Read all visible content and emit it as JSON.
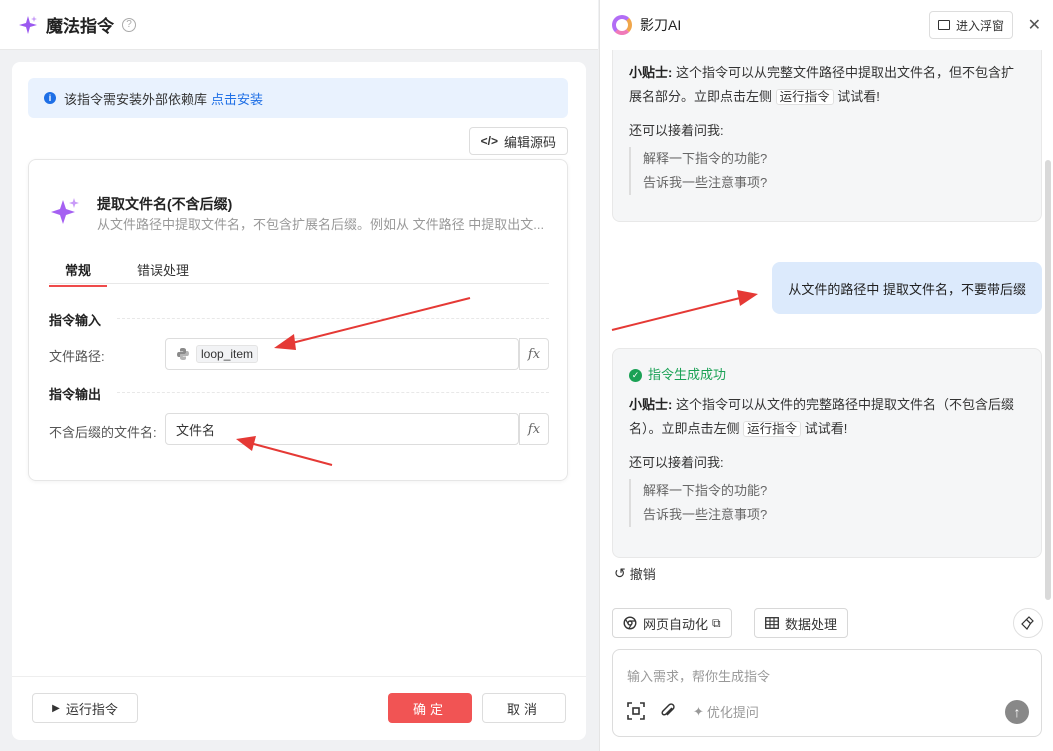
{
  "left": {
    "title": "魔法指令",
    "help": "?",
    "notice": {
      "text": "该指令需安装外部依赖库",
      "link": "点击安装"
    },
    "edit_source": "编辑源码",
    "command": {
      "title": "提取文件名(不含后缀)",
      "description": "从文件路径中提取文件名，不包含扩展名后缀。例如从 文件路径 中提取出文..."
    },
    "tabs": {
      "general": "常规",
      "error": "错误处理"
    },
    "input_section": "指令输入",
    "input_field": {
      "label": "文件路径:",
      "chip": "loop_item"
    },
    "output_section": "指令输出",
    "output_field": {
      "label": "不含后缀的文件名:",
      "value": "文件名"
    },
    "fx": "fx",
    "run_button": "运行指令",
    "ok_button": "确定",
    "cancel_button": "取消"
  },
  "right": {
    "title": "影刀AI",
    "float_button": "进入浮窗",
    "msg1": {
      "tip_label": "小贴士",
      "tip_a": "这个指令可以从完整文件路径中提取出文件名，但不包含扩展名部分。立即点击左侧",
      "tag": "运行指令",
      "tip_b": "试试看!",
      "ask": "还可以接着问我:",
      "q1": "解释一下指令的功能?",
      "q2": "告诉我一些注意事项?"
    },
    "user_msg": "从文件的路径中 提取文件名，不要带后缀",
    "msg2": {
      "success": "指令生成成功",
      "tip_label": "小贴士",
      "tip_a": "这个指令可以从文件的完整路径中提取文件名（不包含后缀名）。立即点击左侧",
      "tag": "运行指令",
      "tip_b": "试试看!",
      "ask": "还可以接着问我:",
      "q1": "解释一下指令的功能?",
      "q2": "告诉我一些注意事项?"
    },
    "undo": "撤销",
    "quick1": "网页自动化",
    "quick2": "数据处理",
    "input_placeholder": "输入需求，帮你生成指令",
    "optimize": "优化提问"
  },
  "colors": {
    "accent_red": "#f15454",
    "link_blue": "#1e6fe6",
    "success_green": "#1aa155",
    "sparkle_purple": "#9b59f0"
  }
}
